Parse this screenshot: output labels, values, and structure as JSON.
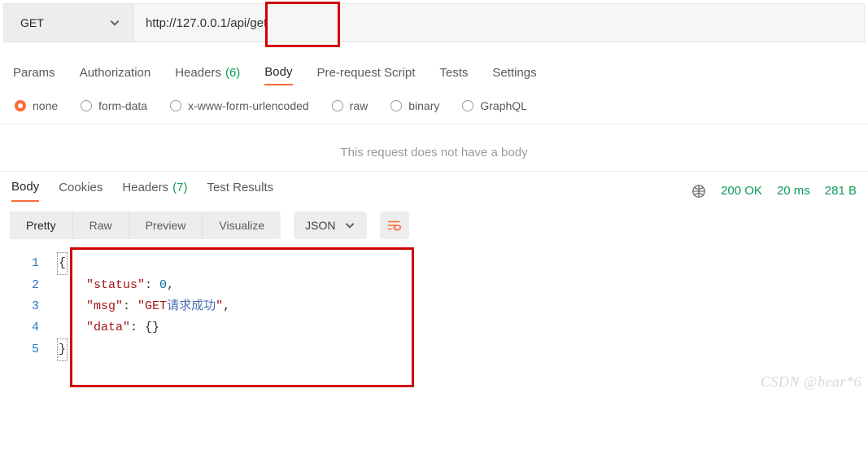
{
  "request": {
    "method": "GET",
    "url": "http://127.0.0.1/api/get",
    "tabs": {
      "params": "Params",
      "auth": "Authorization",
      "headers_label": "Headers",
      "headers_count": "(6)",
      "body": "Body",
      "prereq": "Pre-request Script",
      "tests": "Tests",
      "settings": "Settings"
    },
    "body_types": {
      "none": "none",
      "formdata": "form-data",
      "urlencoded": "x-www-form-urlencoded",
      "raw": "raw",
      "binary": "binary",
      "graphql": "GraphQL"
    },
    "nobody_msg": "This request does not have a body"
  },
  "response": {
    "tabs": {
      "body": "Body",
      "cookies": "Cookies",
      "headers_label": "Headers",
      "headers_count": "(7)",
      "test_results": "Test Results"
    },
    "status": {
      "code": "200 OK",
      "time": "20 ms",
      "size": "281 B"
    },
    "view_modes": {
      "pretty": "Pretty",
      "raw": "Raw",
      "preview": "Preview",
      "visualize": "Visualize"
    },
    "format": "JSON",
    "code_lines": {
      "l1": "{",
      "l2_key": "\"status\"",
      "l2_colon": ": ",
      "l2_val": "0",
      "l2_end": ",",
      "l3_key": "\"msg\"",
      "l3_colon": ": ",
      "l3_val_a": "\"GET",
      "l3_val_b": "请求成功",
      "l3_val_c": "\"",
      "l3_end": ",",
      "l4_key": "\"data\"",
      "l4_colon": ": ",
      "l4_val": "{}",
      "l5": "}"
    }
  },
  "watermark": "CSDN @bear*6"
}
